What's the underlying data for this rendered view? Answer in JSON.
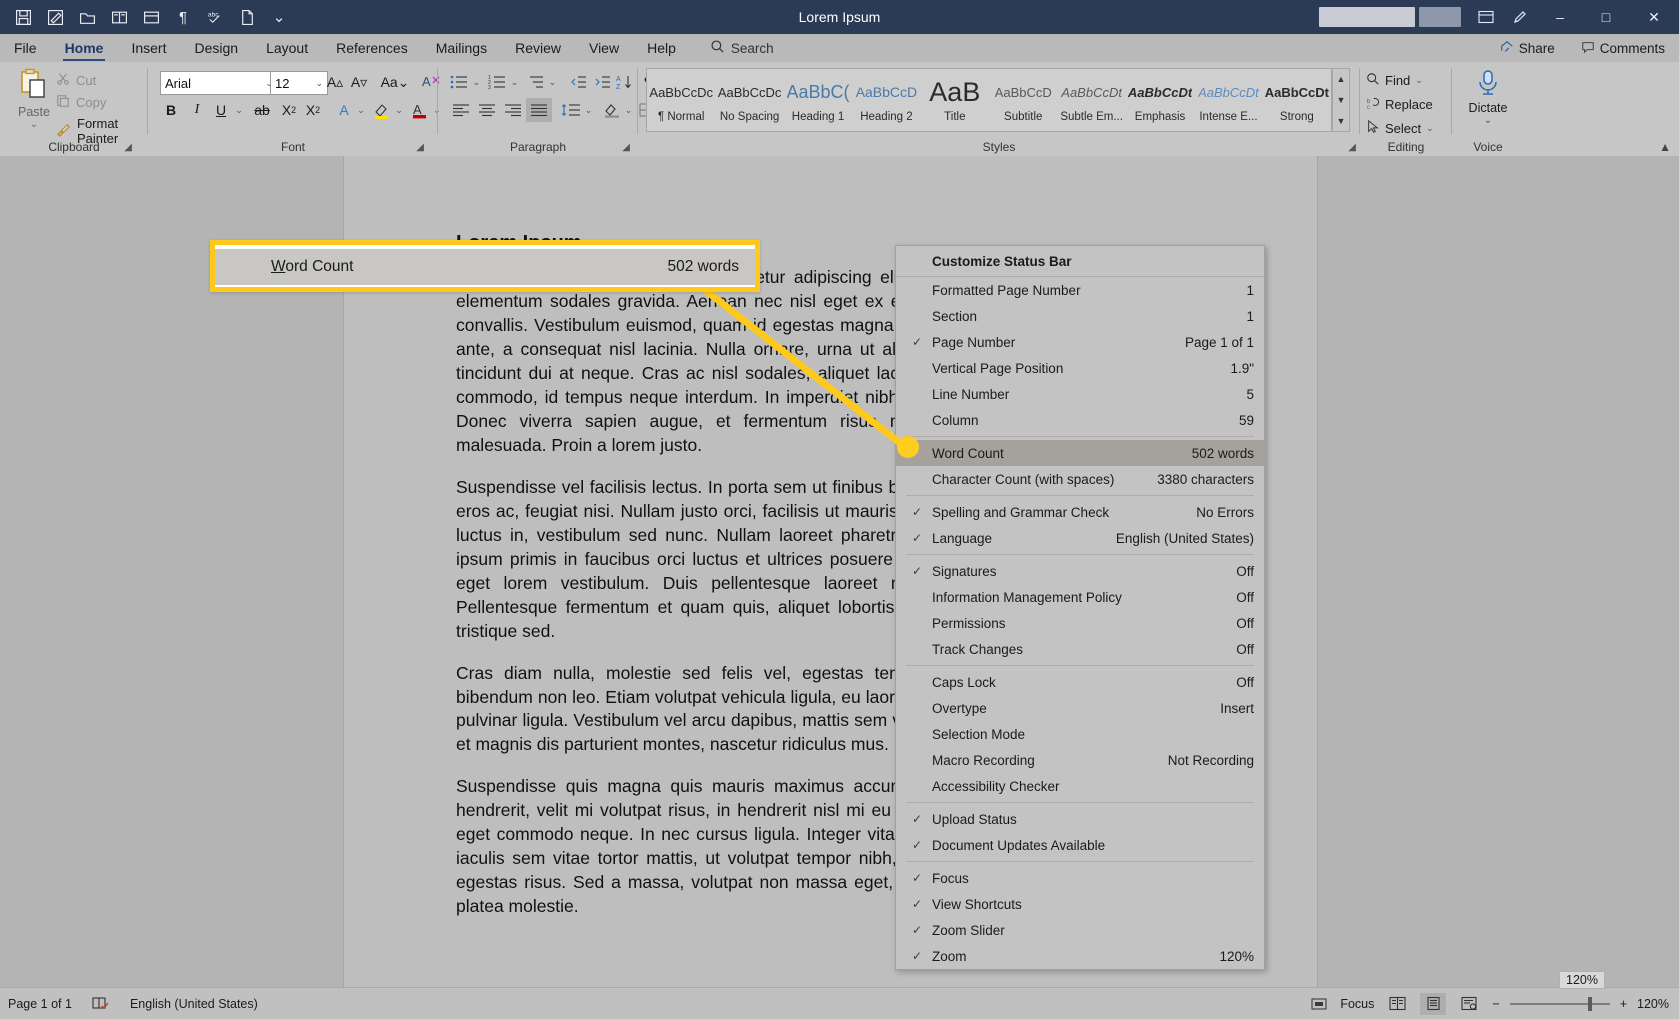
{
  "window": {
    "title": "Lorem Ipsum",
    "quick_access": [
      "save-icon",
      "autosave-icon",
      "open-icon",
      "read-mode-icon",
      "print-preview-icon",
      "formatting-marks-icon",
      "spelling-icon",
      "new-doc-icon",
      "customize-qat-icon"
    ],
    "buttons": {
      "ribbon_options": "ribbon-display-options-icon",
      "minimize": "–",
      "maximize": "□",
      "close": "✕"
    }
  },
  "ribbon": {
    "tabs": [
      {
        "label": "File",
        "active": false
      },
      {
        "label": "Home",
        "active": true
      },
      {
        "label": "Insert",
        "active": false
      },
      {
        "label": "Design",
        "active": false
      },
      {
        "label": "Layout",
        "active": false
      },
      {
        "label": "References",
        "active": false
      },
      {
        "label": "Mailings",
        "active": false
      },
      {
        "label": "Review",
        "active": false
      },
      {
        "label": "View",
        "active": false
      },
      {
        "label": "Help",
        "active": false
      }
    ],
    "search_placeholder": "Search",
    "share_label": "Share",
    "comments_label": "Comments",
    "collapse_icon": "chevron-up-icon",
    "groups": {
      "clipboard": {
        "label": "Clipboard",
        "paste": "Paste",
        "cut": "Cut",
        "copy": "Copy",
        "format_painter": "Format Painter"
      },
      "font": {
        "label": "Font",
        "font_name": "Arial",
        "font_size": "12"
      },
      "paragraph": {
        "label": "Paragraph"
      },
      "styles": {
        "label": "Styles",
        "items": [
          {
            "preview": "AaBbCcDc",
            "name": "¶ Normal"
          },
          {
            "preview": "AaBbCcDc",
            "name": "No Spacing"
          },
          {
            "preview": "AaBbC(",
            "name": "Heading 1"
          },
          {
            "preview": "AaBbCcD",
            "name": "Heading 2"
          },
          {
            "preview": "AaB",
            "name": "Title"
          },
          {
            "preview": "AaBbCcD",
            "name": "Subtitle"
          },
          {
            "preview": "AaBbCcDt",
            "name": "Subtle Em..."
          },
          {
            "preview": "AaBbCcDt",
            "name": "Emphasis"
          },
          {
            "preview": "AaBbCcDt",
            "name": "Intense E..."
          },
          {
            "preview": "AaBbCcDt",
            "name": "Strong"
          }
        ]
      },
      "editing": {
        "label": "Editing",
        "find": "Find",
        "replace": "Replace",
        "select": "Select"
      },
      "voice": {
        "label": "Voice",
        "dictate": "Dictate"
      }
    }
  },
  "document": {
    "title": "Lorem Ipsum",
    "paragraphs": [
      "Lorem ipsum dolor sit amet, consectetur adipiscing elit. Cras sed mauris bibendum. Vivamus elementum sodales gravida. Aenean nec nisl eget ex euismod malesuada. Proin luctus feugiat convallis. Vestibulum euismod, quam id egestas magna in, hendrerit risus. Vivamus cursus enim ante, a consequat nisl lacinia. Nulla ornare, urna ut aliquam luctus, sapien ex feugiat nibh, id tincidunt dui at neque. Cras ac nisl sodales, aliquet lacus ut, lacinia turpis. Curabitur at sapien commodo, id tempus neque interdum. In imperdiet nibh non lorem porta, a tristique elit tempor. Donec viverra sapien augue, et fermentum risus mollis quis. Donec aliquet consectetur malesuada. Proin a lorem justo.",
      "Suspendisse vel facilisis lectus. In porta sem ut finibus bibendum. Donec sit amet egestas, mollis eros ac, feugiat nisi. Nullam justo orci, facilisis ut mauris sed, luctus nisi. Duis erat ex, finibus vel luctus in, vestibulum sed nunc. Nullam laoreet pharetra mauris tempus eget. Vestibulum ante ipsum primis in faucibus orci luctus et ultrices posuere cubilia Curae; Curabitur porttitor magna eget lorem vestibulum. Duis pellentesque laoreet mi, faucibus tincidunt est tristique at. Pellentesque fermentum et quam quis, aliquet lobortis tortor. Nulla facilisi. Curabitur non sem tristique sed.",
      "Cras diam nulla, molestie sed felis vel, egestas tempus nunc. Nam faucibus sodales ac, bibendum non leo. Etiam volutpat vehicula ligula, eu laoreet nibh non. Nam quis pulvinar velit, nec pulvinar ligula. Vestibulum vel arcu dapibus, mattis sem varius nec. Orci varius natoque penatibus et magnis dis parturient montes, nascetur ridiculus mus. In tempus varius tincidunt.",
      "Suspendisse quis magna quis mauris maximus accumsan at eget lacus. Nulla vitae tempor hendrerit, velit mi volutpat risus, in hendrerit nisl mi eu eros. Nullam quis dignissim ex. Aliquam eget commodo neque. In nec cursus ligula. Integer vitae eget dictum in, sodales ac ligula. Cras iaculis sem vitae tortor mattis, ut volutpat tempor nibh, at scelerisque diam lacinia et. Nunc at egestas risus. Sed a massa, volutpat non massa eget, gravida tempus quam. In hac habitasse platea molestie."
    ]
  },
  "callout": {
    "label": "Word Count",
    "value": "502 words",
    "highlight_color": "#ffc91b",
    "accent_dot_color": "#ffcd1f"
  },
  "context_menu": {
    "title": "Customize Status Bar",
    "items": [
      {
        "label": "Formatted Page Number",
        "value": "1",
        "checked": false,
        "selected": false,
        "sep_after": false
      },
      {
        "label": "Section",
        "value": "1",
        "checked": false,
        "selected": false,
        "sep_after": false
      },
      {
        "label": "Page Number",
        "value": "Page 1 of 1",
        "checked": true,
        "selected": false,
        "sep_after": false
      },
      {
        "label": "Vertical Page Position",
        "value": "1.9\"",
        "checked": false,
        "selected": false,
        "sep_after": false
      },
      {
        "label": "Line Number",
        "value": "5",
        "checked": false,
        "selected": false,
        "sep_after": false
      },
      {
        "label": "Column",
        "value": "59",
        "checked": false,
        "selected": false,
        "sep_after": true
      },
      {
        "label": "Word Count",
        "value": "502 words",
        "checked": false,
        "selected": true,
        "sep_after": false
      },
      {
        "label": "Character Count (with spaces)",
        "value": "3380 characters",
        "checked": false,
        "selected": false,
        "sep_after": true
      },
      {
        "label": "Spelling and Grammar Check",
        "value": "No Errors",
        "checked": true,
        "selected": false,
        "sep_after": false
      },
      {
        "label": "Language",
        "value": "English (United States)",
        "checked": true,
        "selected": false,
        "sep_after": true
      },
      {
        "label": "Signatures",
        "value": "Off",
        "checked": true,
        "selected": false,
        "sep_after": false
      },
      {
        "label": "Information Management Policy",
        "value": "Off",
        "checked": false,
        "selected": false,
        "sep_after": false
      },
      {
        "label": "Permissions",
        "value": "Off",
        "checked": false,
        "selected": false,
        "sep_after": false
      },
      {
        "label": "Track Changes",
        "value": "Off",
        "checked": false,
        "selected": false,
        "sep_after": true
      },
      {
        "label": "Caps Lock",
        "value": "Off",
        "checked": false,
        "selected": false,
        "sep_after": false
      },
      {
        "label": "Overtype",
        "value": "Insert",
        "checked": false,
        "selected": false,
        "sep_after": false
      },
      {
        "label": "Selection Mode",
        "value": "",
        "checked": false,
        "selected": false,
        "sep_after": false
      },
      {
        "label": "Macro Recording",
        "value": "Not Recording",
        "checked": false,
        "selected": false,
        "sep_after": false
      },
      {
        "label": "Accessibility Checker",
        "value": "",
        "checked": false,
        "selected": false,
        "sep_after": true
      },
      {
        "label": "Upload Status",
        "value": "",
        "checked": true,
        "selected": false,
        "sep_after": false
      },
      {
        "label": "Document Updates Available",
        "value": "",
        "checked": true,
        "selected": false,
        "sep_after": true
      },
      {
        "label": "Focus",
        "value": "",
        "checked": true,
        "selected": false,
        "sep_after": false
      },
      {
        "label": "View Shortcuts",
        "value": "",
        "checked": true,
        "selected": false,
        "sep_after": false
      },
      {
        "label": "Zoom Slider",
        "value": "",
        "checked": true,
        "selected": false,
        "sep_after": false
      },
      {
        "label": "Zoom",
        "value": "120%",
        "checked": true,
        "selected": false,
        "sep_after": false
      }
    ]
  },
  "statusbar": {
    "page": "Page 1 of 1",
    "proofing_icon": "proofing-errors-icon",
    "language": "English (United States)",
    "focus": "Focus",
    "views": [
      "read-mode-icon",
      "print-layout-icon",
      "web-layout-icon"
    ],
    "active_view": "print-layout-icon",
    "zoom_out": "−",
    "zoom_in": "+",
    "zoom_level": "120%",
    "zoom_tooltip": "120%"
  }
}
